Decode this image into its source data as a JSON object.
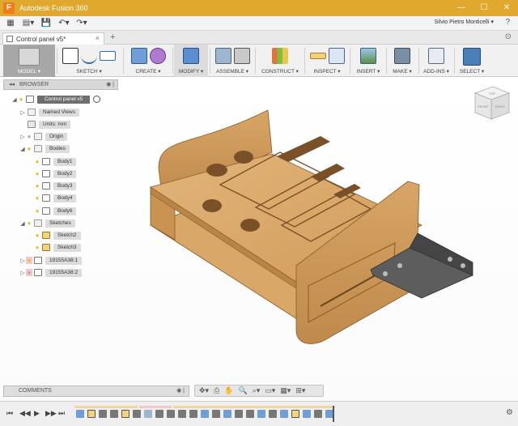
{
  "window": {
    "title": "Autodesk Fusion 360",
    "logo": "F"
  },
  "quickbar": {
    "user": "Silvio Pietro Monticelli ▾",
    "help": "?"
  },
  "tab": {
    "label": "Control panel v5*",
    "close": "×",
    "add": "+"
  },
  "toolbar": {
    "groups": [
      {
        "id": "model",
        "label": "MODEL ▾"
      },
      {
        "id": "sketch",
        "label": "SKETCH ▾"
      },
      {
        "id": "create",
        "label": "CREATE ▾"
      },
      {
        "id": "modify",
        "label": "MODIFY ▾"
      },
      {
        "id": "assemble",
        "label": "ASSEMBLE ▾"
      },
      {
        "id": "construct",
        "label": "CONSTRUCT ▾"
      },
      {
        "id": "inspect",
        "label": "INSPECT ▾"
      },
      {
        "id": "insert",
        "label": "INSERT ▾"
      },
      {
        "id": "make",
        "label": "MAKE ▾"
      },
      {
        "id": "addins",
        "label": "ADD-INS ▾"
      },
      {
        "id": "select",
        "label": "SELECT ▾"
      }
    ]
  },
  "browser": {
    "title": "BROWSER",
    "root": "Control panel v5",
    "named_views": "Named Views",
    "units": "Units: mm",
    "origin": "Origin",
    "bodies": "Bodies",
    "body_items": [
      "Body1",
      "Body2",
      "Body3",
      "Body4",
      "Body6"
    ],
    "sketches": "Sketches",
    "sketch_items": [
      "Sketch2",
      "Sketch3"
    ],
    "components": [
      "19155A38:1",
      "19155A38:2"
    ]
  },
  "viewcube": {
    "top": "TOP",
    "front": "FRONT",
    "right": "RIGHT"
  },
  "comments": {
    "label": "COMMENTS"
  },
  "colors": {
    "titlebar": "#e0a92e",
    "wood": "#d9a868",
    "bracket": "#555555"
  }
}
